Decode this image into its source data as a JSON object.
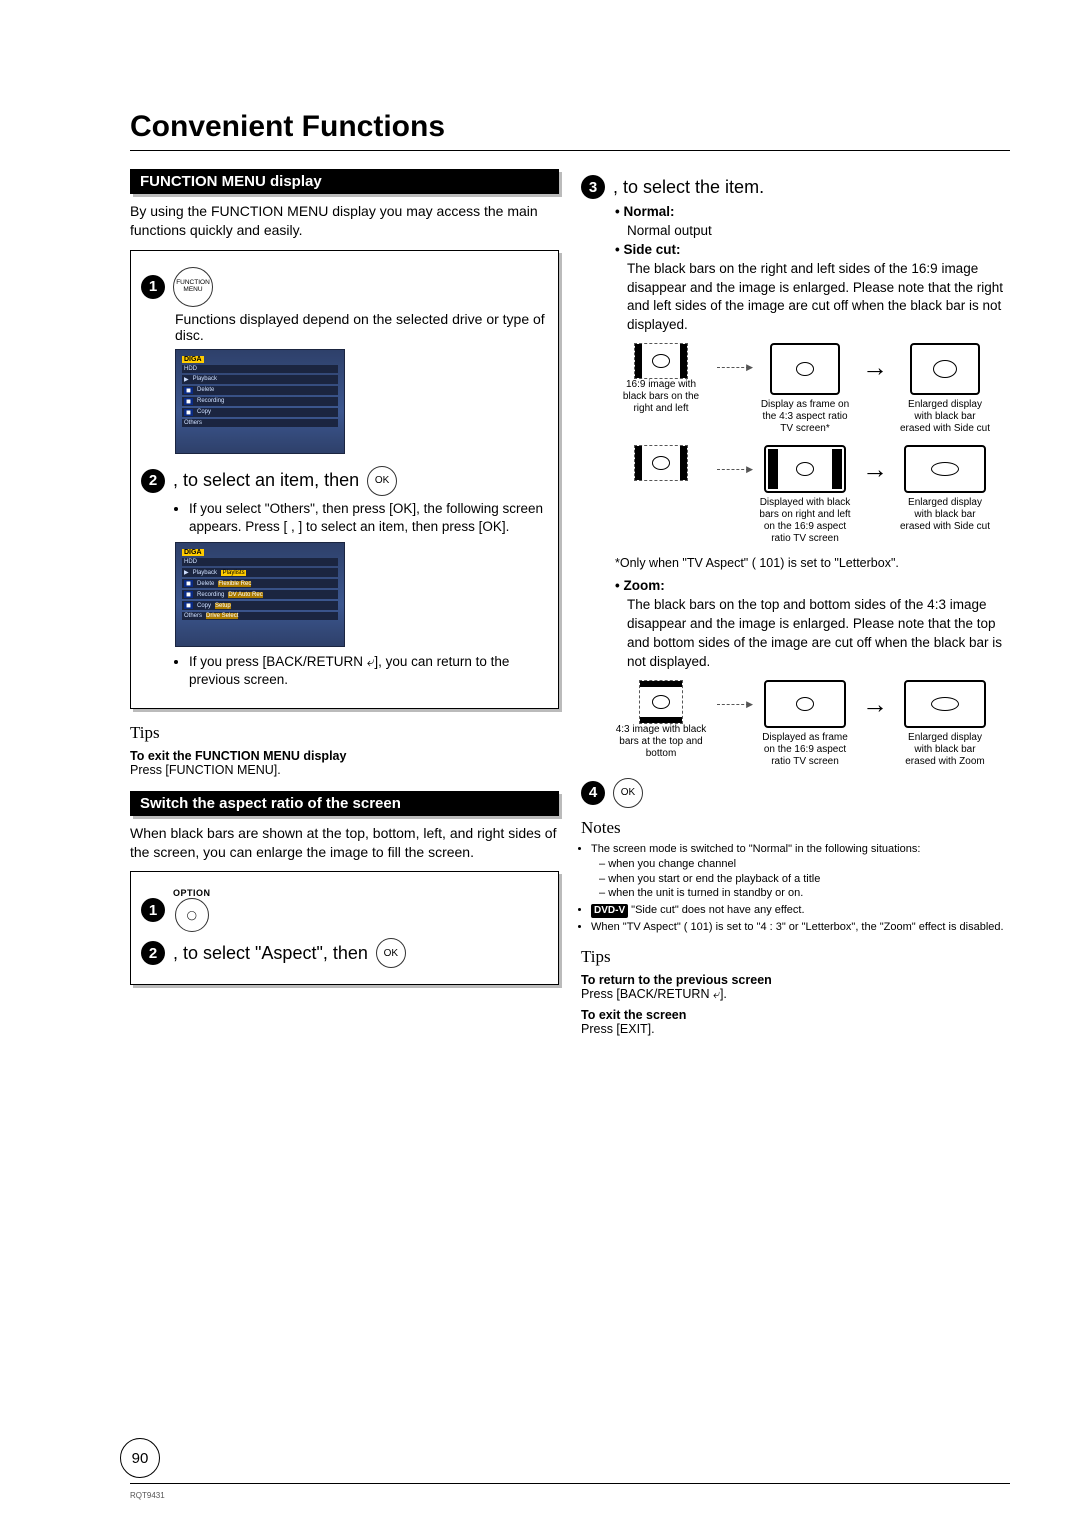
{
  "page": {
    "title": "Convenient Functions",
    "number": "90",
    "doc_code": "RQT9431"
  },
  "left": {
    "sec1_header": "FUNCTION MENU display",
    "sec1_intro": "By using the FUNCTION MENU display you may access the main functions quickly and easily.",
    "step1_label": "1",
    "step1_badge": "FUNCTION MENU",
    "step1_note": "Functions displayed depend on the selected drive or type of disc.",
    "step2_label": "2",
    "step2_text": ",      to select an item, then",
    "ok_label": "OK",
    "step2_bullet1": "If you select \"Others\", then press [OK], the following screen appears. Press [   ,   ] to select an item, then press [OK].",
    "step2_bullet2": "If you press [BACK/RETURN ⤶], you can return to the previous screen.",
    "tips_heading": "Tips",
    "tips1_bold": "To exit the FUNCTION MENU display",
    "tips1_line": "Press [FUNCTION MENU].",
    "sec2_header": "Switch the aspect ratio of the screen",
    "sec2_intro": "When black bars are shown at the top, bottom, left, and right sides of the screen, you can enlarge the image to fill the screen.",
    "sec2_step1_label": "1",
    "option_label": "OPTION",
    "sec2_step2_label": "2",
    "sec2_step2_text": ",      to select \"Aspect\", then"
  },
  "right": {
    "step3_label": "3",
    "step3_text": ",      to select the item.",
    "normal_label": "Normal:",
    "normal_text": "Normal output",
    "sidecut_label": "Side cut:",
    "sidecut_text": "The black bars on the right and left sides of the 16:9 image disappear and the image is enlarged. Please note that the right and left sides of the image are cut off when the black bar is not displayed.",
    "cap_169_bars": "16:9 image with black bars on the right and left",
    "cap_43_frame": "Display as frame on the 4:3 aspect ratio TV screen*",
    "cap_enlarged_sidecut": "Enlarged display with black bar erased with Side cut",
    "cap_ws_blackbars": "Displayed with black bars on right and left on the 16:9 aspect ratio TV screen",
    "cap_enlarged_sidecut2": "Enlarged display with black bar erased with Side cut",
    "anchor_note": "*Only when \"TV Aspect\" ( 101) is set to \"Letterbox\".",
    "zoom_label": "Zoom:",
    "zoom_text": "The black bars on the top and bottom sides of the 4:3 image disappear and the image is enlarged. Please note that the top and bottom sides of the image are cut off when the black bar is not displayed.",
    "cap_43_bars": "4:3 image with black bars at the top and bottom",
    "cap_169_frame": "Displayed as frame on the 16:9 aspect ratio TV screen",
    "cap_enlarged_zoom": "Enlarged display with black bar erased with Zoom",
    "step4_label": "4",
    "notes_heading": "Notes",
    "note1": "The screen mode is switched to \"Normal\" in the following situations:",
    "note1a": "when you change channel",
    "note1b": "when you start or end the playback of a title",
    "note1c": "when the unit is turned in standby or on.",
    "dvdv": "DVD-V",
    "note2": " \"Side cut\" does not have any effect.",
    "note3": "When \"TV Aspect\" ( 101) is set to \"4 : 3\" or \"Letterbox\", the \"Zoom\" effect is disabled.",
    "tips_heading": "Tips",
    "tips2_bold_a": "To return to the previous screen",
    "tips2_line_a": "Press [BACK/RETURN ⤶].",
    "tips2_bold_b": "To exit the screen",
    "tips2_line_b": "Press [EXIT]."
  }
}
